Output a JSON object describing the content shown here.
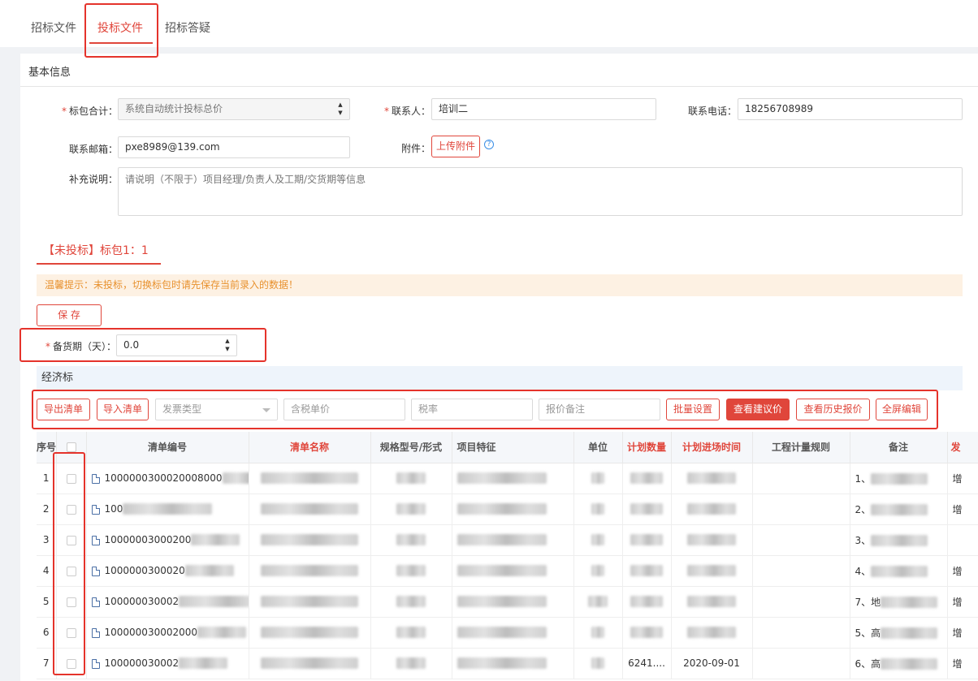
{
  "tabs": [
    {
      "label": "招标文件",
      "active": false
    },
    {
      "label": "投标文件",
      "active": true
    },
    {
      "label": "招标答疑",
      "active": false
    }
  ],
  "basic": {
    "title": "基本信息",
    "package_total": {
      "label": "标包合计：",
      "value": "系统自动统计投标总价"
    },
    "contact": {
      "label": "联系人：",
      "value": "培训二"
    },
    "phone": {
      "label": "联系电话：",
      "value": "18256708989"
    },
    "email": {
      "label": "联系邮箱：",
      "value": "pxe8989@139.com"
    },
    "attachment": {
      "label": "附件：",
      "button": "上传附件"
    },
    "remark": {
      "label": "补充说明：",
      "placeholder": "请说明（不限于）项目经理/负责人及工期/交货期等信息"
    }
  },
  "package_tab": "【未投标】标包1：1",
  "tip": "温馨提示：未投标，切换标包时请先保存当前录入的数据！",
  "save_label": "保 存",
  "stock_period": {
    "label": "备货期（天）：",
    "value": "0.0"
  },
  "econ_title": "经济标",
  "toolbar": {
    "export": "导出清单",
    "import": "导入清单",
    "invoice_type": "发票类型",
    "unit_price": "含税单价",
    "tax_rate": "税率",
    "quote_remark": "报价备注",
    "batch": "批量设置",
    "suggest": "查看建议价",
    "history": "查看历史报价",
    "fullscreen": "全屏编辑"
  },
  "table": {
    "columns": [
      "序号",
      "",
      "清单编号",
      "清单名称",
      "规格型号/形式",
      "项目特征",
      "单位",
      "计划数量",
      "计划进场时间",
      "工程计量规则",
      "备注",
      "发"
    ],
    "rows": [
      {
        "no": "1",
        "code": "1000000300020008000",
        "qty": "",
        "date": "",
        "remark": "1、",
        "last": "增"
      },
      {
        "no": "2",
        "code": "100",
        "qty": "",
        "date": "",
        "remark": "2、",
        "last": "增"
      },
      {
        "no": "3",
        "code": "10000003000200",
        "qty": "",
        "date": "",
        "remark": "3、",
        "last": ""
      },
      {
        "no": "4",
        "code": "1000000300020",
        "qty": "",
        "date": "",
        "remark": "4、",
        "last": "增"
      },
      {
        "no": "5",
        "code": "100000030002",
        "qty": "",
        "date": "",
        "remark": "7、地",
        "last": "增"
      },
      {
        "no": "6",
        "code": "100000030002000",
        "qty": "",
        "date": "",
        "remark": "5、高",
        "last": "增"
      },
      {
        "no": "7",
        "code": "100000030002",
        "qty": "6241....",
        "date": "2020-09-01",
        "remark": "6、高",
        "last": "增"
      }
    ]
  }
}
